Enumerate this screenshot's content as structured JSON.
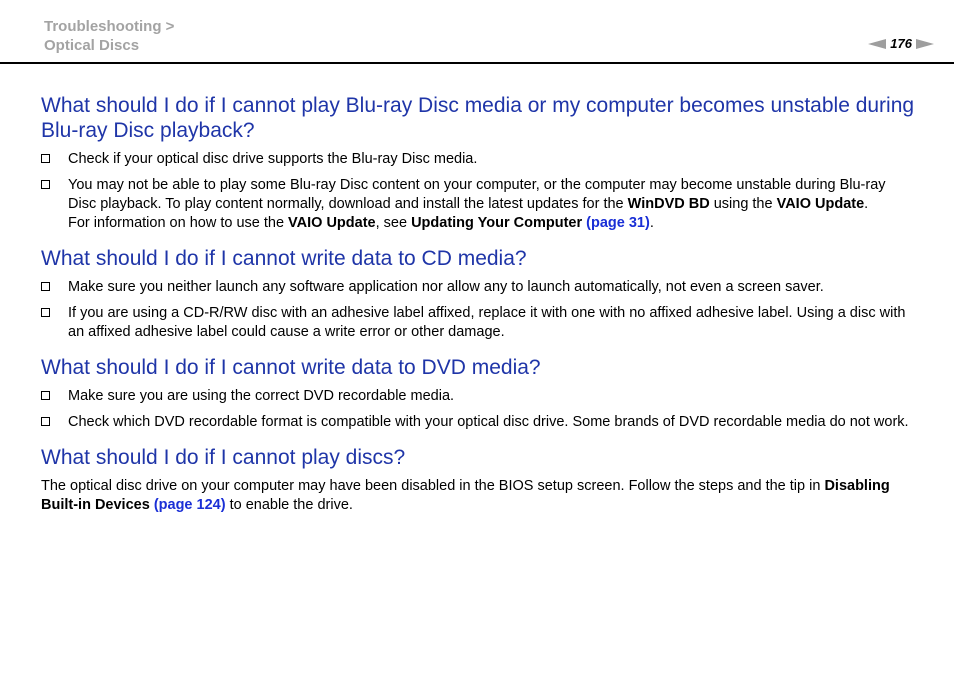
{
  "header": {
    "breadcrumb_1": "Troubleshooting >",
    "breadcrumb_2": "Optical Discs",
    "page_number": "176"
  },
  "sections": [
    {
      "heading": "What should I do if I cannot play Blu-ray Disc media or my computer becomes unstable during Blu-ray Disc playback?",
      "items": [
        {
          "text": "Check if your optical disc drive supports the Blu-ray Disc media."
        },
        {
          "t1": "You may not be able to play some Blu-ray Disc content on your computer, or the computer may become unstable during Blu-ray Disc playback. To play content normally, download and install the latest updates for the ",
          "b1": "WinDVD BD",
          "t2": " using the ",
          "b2": "VAIO Update",
          "t3": ".",
          "s1": "For information on how to use the ",
          "sb1": "VAIO Update",
          "s2": ", see ",
          "sb2": "Updating Your Computer",
          "s3": " ",
          "link": "(page 31)",
          "s4": "."
        }
      ]
    },
    {
      "heading": "What should I do if I cannot write data to CD media?",
      "items": [
        {
          "text": "Make sure you neither launch any software application nor allow any to launch automatically, not even a screen saver."
        },
        {
          "text": "If you are using a CD-R/RW disc with an adhesive label affixed, replace it with one with no affixed adhesive label. Using a disc with an affixed adhesive label could cause a write error or other damage."
        }
      ]
    },
    {
      "heading": "What should I do if I cannot write data to DVD media?",
      "items": [
        {
          "text": "Make sure you are using the correct DVD recordable media."
        },
        {
          "text": "Check which DVD recordable format is compatible with your optical disc drive. Some brands of DVD recordable media do not work."
        }
      ]
    },
    {
      "heading": "What should I do if I cannot play discs?",
      "paragraph": {
        "t1": "The optical disc drive on your computer may have been disabled in the BIOS setup screen. Follow the steps and the tip in ",
        "b1": "Disabling Built-in Devices",
        "t2": " ",
        "link": "(page 124)",
        "t3": " to enable the drive."
      }
    }
  ]
}
